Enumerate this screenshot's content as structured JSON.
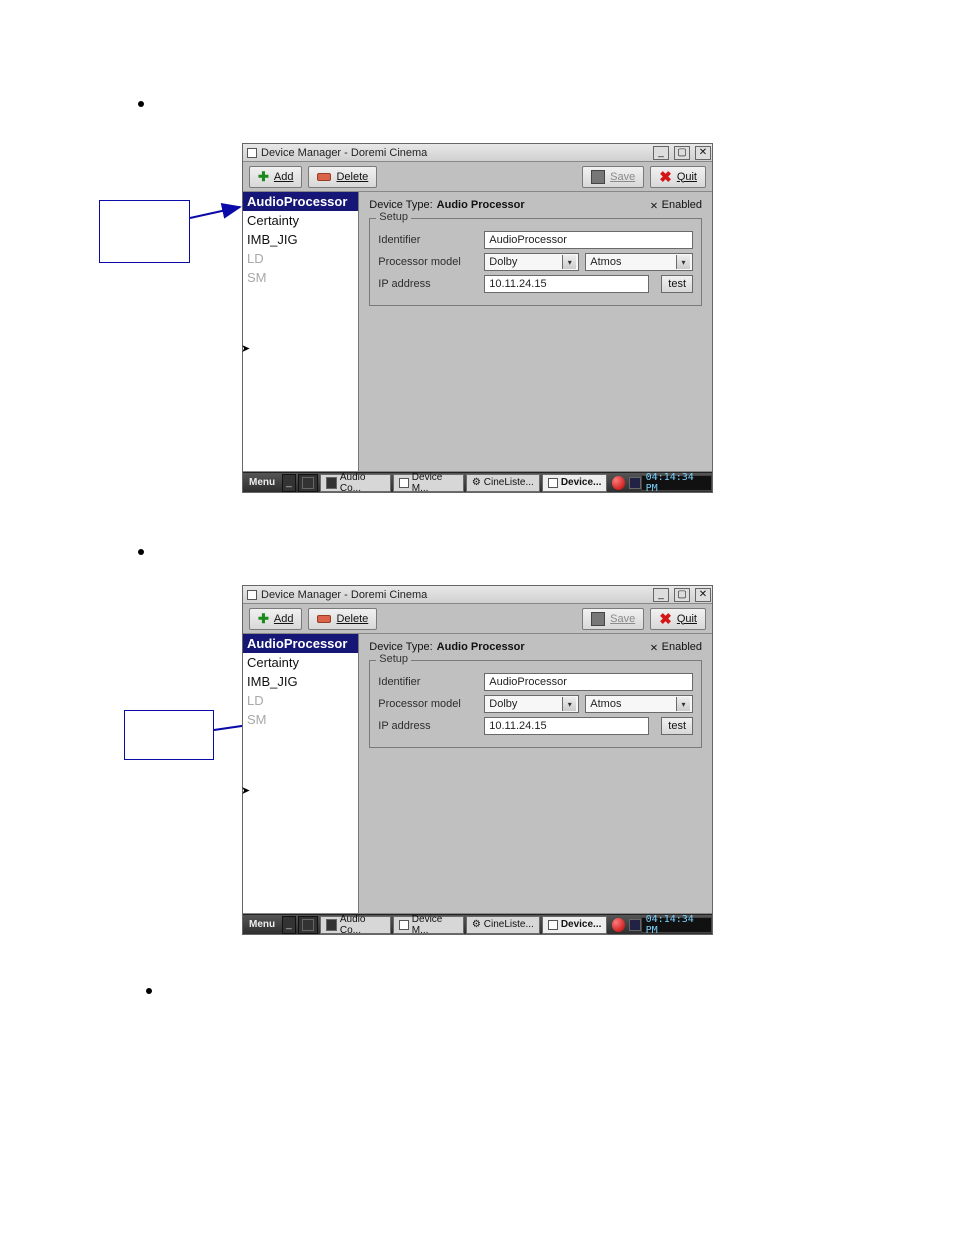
{
  "window": {
    "title": "Device Manager - Doremi Cinema",
    "toolbar": {
      "add": "Add",
      "delete": "Delete",
      "save": "Save",
      "quit": "Quit"
    },
    "sidebar": {
      "items": [
        {
          "label": "AudioProcessor",
          "selected": true
        },
        {
          "label": "Certainty"
        },
        {
          "label": "IMB_JIG"
        },
        {
          "label": "LD",
          "dim": true
        },
        {
          "label": "SM",
          "dim": true
        }
      ]
    },
    "main": {
      "devtype_label": "Device Type:",
      "devtype_value": "Audio Processor",
      "enabled_label": "Enabled",
      "setup_legend": "Setup",
      "identifier_label": "Identifier",
      "identifier_value": "AudioProcessor",
      "procmodel_label": "Processor model",
      "procmodel_brand": "Dolby",
      "procmodel_model": "Atmos",
      "ip_label": "IP address",
      "ip_value": "10.11.24.15",
      "test_label": "test"
    },
    "taskbar": {
      "menu": "Menu",
      "items": [
        "Audio Co...",
        "Device M...",
        "CineListe...",
        "Device..."
      ],
      "clock": "04:14:34 PM"
    }
  }
}
